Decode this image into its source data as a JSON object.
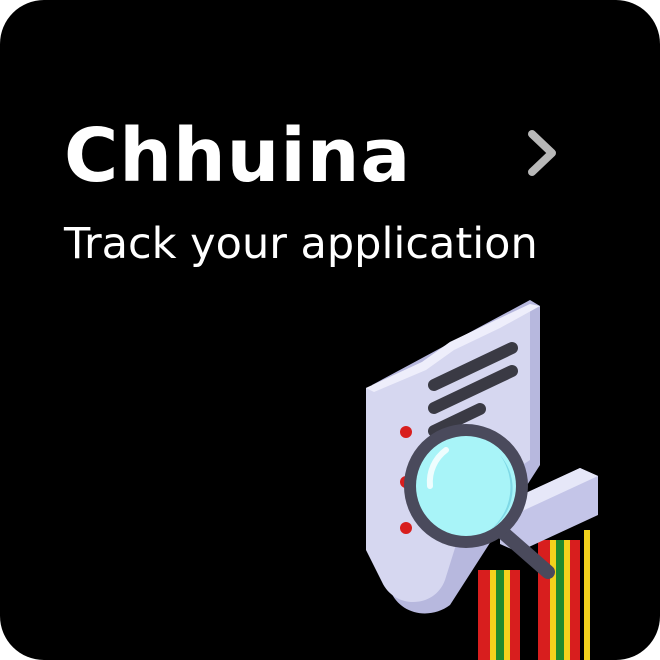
{
  "card": {
    "title": "Chhuina",
    "subtitle": "Track your application"
  },
  "icons": {
    "chevron": "chevron-right-icon",
    "illustration": "document-search-illustration"
  },
  "colors": {
    "background": "#000000",
    "text": "#ffffff",
    "chevron": "#b8b8b8",
    "paper": "#d6d7f0",
    "paper_edge": "#b7b8de",
    "lens": "#a8f4f8",
    "lens_ring": "#4a4a5c",
    "cable_red": "#d81e1e",
    "cable_yellow": "#f2d21c",
    "cable_green": "#1e8a2e"
  }
}
